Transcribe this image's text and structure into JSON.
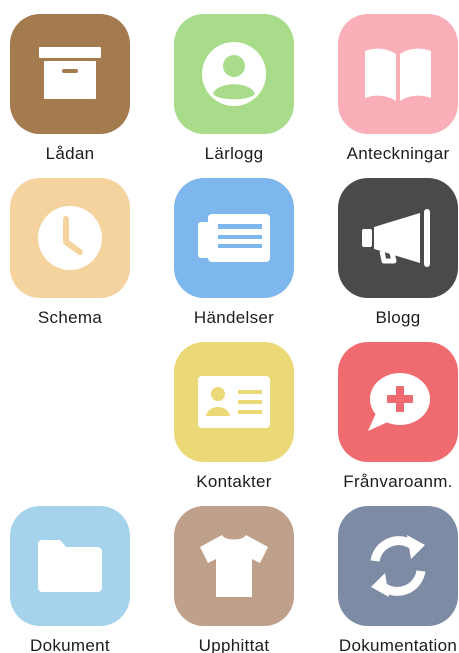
{
  "apps": [
    {
      "id": "ladan",
      "label": "Lådan",
      "color": "#a47a4f",
      "icon": "archive-box-icon"
    },
    {
      "id": "larlogg",
      "label": "Lärlogg",
      "color": "#a8dc8a",
      "icon": "user-profile-icon"
    },
    {
      "id": "anteckningar",
      "label": "Anteckningar",
      "color": "#f9aeb8",
      "icon": "open-book-icon"
    },
    {
      "id": "schema",
      "label": "Schema",
      "color": "#f5d39e",
      "icon": "clock-icon"
    },
    {
      "id": "handelser",
      "label": "Händelser",
      "color": "#7eb6ee",
      "icon": "newspaper-icon"
    },
    {
      "id": "blogg",
      "label": "Blogg",
      "color": "#4a4a4a",
      "icon": "megaphone-icon"
    },
    {
      "id": "kontakter",
      "label": "Kontakter",
      "color": "#ebd876",
      "icon": "contact-card-icon"
    },
    {
      "id": "franvaroanm",
      "label": "Frånvaroanm.",
      "color": "#f06b70",
      "icon": "medical-chat-icon"
    },
    {
      "id": "dokument",
      "label": "Dokument",
      "color": "#a4d3eb",
      "icon": "folder-icon"
    },
    {
      "id": "upphittat",
      "label": "Upphittat",
      "color": "#bfa08a",
      "icon": "tshirt-icon"
    },
    {
      "id": "dokumentation",
      "label": "Dokumentation",
      "color": "#7d8ba4",
      "icon": "sync-arrows-icon"
    }
  ]
}
